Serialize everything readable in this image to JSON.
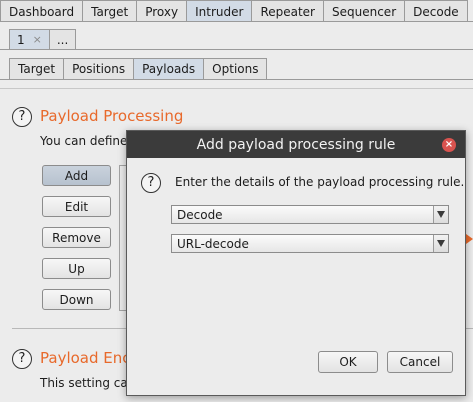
{
  "main_tabs": [
    "Dashboard",
    "Target",
    "Proxy",
    "Intruder",
    "Repeater",
    "Sequencer",
    "Decode"
  ],
  "main_tab_active": "Intruder",
  "attack_tabs": {
    "tab1_label": "1",
    "tab1_close": "×",
    "more_label": "..."
  },
  "inner_tabs": [
    "Target",
    "Positions",
    "Payloads",
    "Options"
  ],
  "inner_tab_active": "Payloads",
  "payload_processing": {
    "help": "?",
    "title": "Payload Processing",
    "desc": "You can define",
    "buttons": {
      "add": "Add",
      "edit": "Edit",
      "remove": "Remove",
      "up": "Up",
      "down": "Down"
    }
  },
  "payload_encoding": {
    "help": "?",
    "title": "Payload Enc",
    "desc": "This setting ca"
  },
  "dialog": {
    "title": "Add payload processing rule",
    "close": "×",
    "help": "?",
    "message": "Enter the details of the payload processing rule.",
    "rule_type": "Decode",
    "rule_option": "URL-decode",
    "ok": "OK",
    "cancel": "Cancel"
  },
  "colors": {
    "accent": "#e8692b",
    "titlebar": "#3b3b3b",
    "close": "#d9534f",
    "active_tab": "#d2dbe6"
  }
}
